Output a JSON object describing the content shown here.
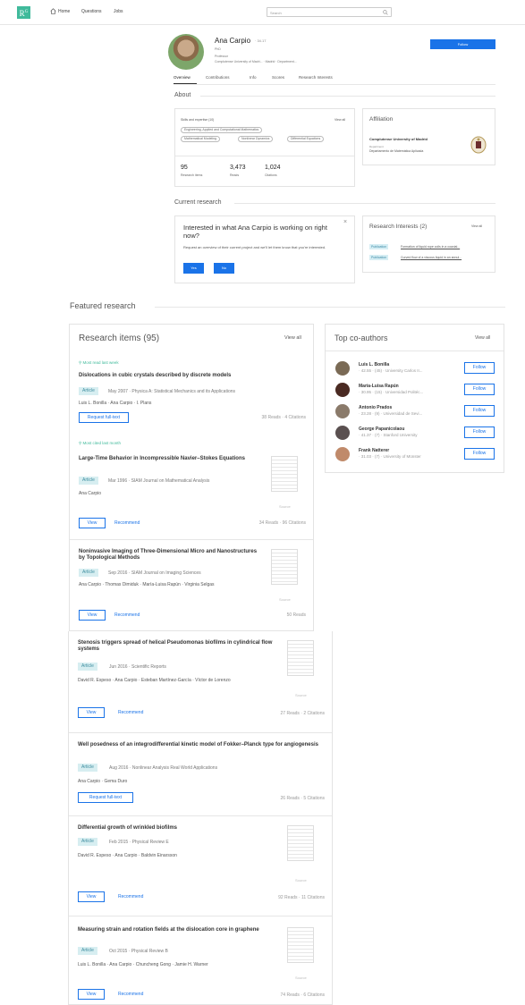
{
  "nav": {
    "logo": "R",
    "logo_sup": "G",
    "home": "Home",
    "questions": "Questions",
    "jobs": "Jobs",
    "search_placeholder": "Search"
  },
  "profile": {
    "name": "Ana Carpio",
    "score": "· 34.17",
    "degree": "PhD",
    "position": "Professor",
    "institution": "Complutense University of Madri... · Madrid · Department...",
    "follow": "Follow",
    "tabs": [
      "Overview",
      "Contributions",
      "Info",
      "Scores",
      "Research Interests"
    ]
  },
  "about": {
    "title": "About",
    "skills_label": "Skills and expertise (10)",
    "view_all": "View all",
    "skills": [
      "Engineering, Applied and Computational Mathematics",
      "Mathematical Modeling",
      "Nonlinear Dynamics",
      "Differential Equations"
    ],
    "stats": [
      {
        "num": "95",
        "label": "Research items"
      },
      {
        "num": "3,473",
        "label": "Reads"
      },
      {
        "num": "1,024",
        "label": "Citations"
      }
    ]
  },
  "affiliation": {
    "title": "Affiliation",
    "university": "Complutense University of Madrid",
    "dept_label": "Department",
    "dept": "Departamento de Matemática Aplicada"
  },
  "current_research": {
    "title": "Current research",
    "question": "Interested in what Ana Carpio is working on right now?",
    "desc": "Request an overview of their current project and we'll let them know that you're interested.",
    "yes": "Yes",
    "no": "No",
    "close": "×"
  },
  "interests": {
    "title": "Research Interests (2)",
    "view_all": "View all",
    "items": [
      {
        "tag": "Publication",
        "text": "Formation of liquid rope coils in a coaxial..."
      },
      {
        "tag": "Publication",
        "text": "Curved flow of a viscous liquid in an annul..."
      }
    ]
  },
  "featured": {
    "title": "Featured research",
    "items_title": "Research items (95)",
    "view_all": "View all",
    "most_read": "Most read last week",
    "most_cited": "Most cited last month",
    "source": "Source",
    "article": "Article",
    "items": [
      {
        "title": "Dislocations in cubic crystals described by discrete models",
        "date": "May 2007 · Physica A: Statistical Mechanics and its Applications",
        "authors": "Luis L. Bonilla · Ana Carpio · I. Plans",
        "btn1": "Request full-text",
        "stats": "38 Reads · 4 Citations"
      },
      {
        "title": "Large-Time Behavior in Incompressible Navier–Stokes Equations",
        "date": "Mar 1996 · SIAM Journal on Mathematical Analysis",
        "authors": "Ana Carpio",
        "btn1": "View",
        "btn2": "Recommend",
        "stats": "34 Reads · 96 Citations"
      },
      {
        "title": "Noninvasive Imaging of Three-Dimensional Micro and Nanostructures by Topological Methods",
        "date": "Sep 2016 · SIAM Journal on Imaging Sciences",
        "authors": "Ana Carpio · Thomas Dimiduk · María-Luisa Rapún · Virginia Selgas",
        "btn1": "View",
        "btn2": "Recommend",
        "stats": "50 Reads"
      },
      {
        "title": "Stenosis triggers spread of helical Pseudomonas biofilms in cylindrical flow systems",
        "date": "Jun 2016 · Scientific Reports",
        "authors": "David R. Espeso · Ana Carpio · Esteban Martínez-García · Víctor de Lorenzo",
        "btn1": "View",
        "btn2": "Recommend",
        "stats": "27 Reads · 2 Citations"
      },
      {
        "title": "Well posedness of an integrodifferential kinetic model of Fokker–Planck type for angiogenesis",
        "date": "Aug 2016 · Nonlinear Analysis Real World Applications",
        "authors": "Ana Carpio · Gema Duro",
        "btn1": "Request full-text",
        "stats": "26 Reads · 5 Citations"
      },
      {
        "title": "Differential growth of wrinkled biofilms",
        "date": "Feb 2015 · Physical Review E",
        "authors": "David R. Espeso · Ana Carpio · Baldvin Einarsson",
        "btn1": "View",
        "btn2": "Recommend",
        "stats": "92 Reads · 11 Citations"
      },
      {
        "title": "Measuring strain and rotation fields at the dislocation core in graphene",
        "date": "Oct 2015 · Physical Review B",
        "authors": "Luis L. Bonilla · Ana Carpio · Chuncheng Gong · Jamie H. Warner",
        "btn1": "View",
        "btn2": "Recommend",
        "stats": "74 Reads · 6 Citations"
      }
    ]
  },
  "coauthors": {
    "title": "Top co-authors",
    "view_all": "View all",
    "follow": "Follow",
    "items": [
      {
        "name": "Luis L. Bonilla",
        "meta": "· 42.55 · (45) · University Carlos II..."
      },
      {
        "name": "María-Luisa Rapún",
        "meta": "· 30.95 · (15) · Universidad Politéc..."
      },
      {
        "name": "Antonio Prados",
        "meta": "· 23.28 · (9) · Universidad de Sevi..."
      },
      {
        "name": "George Papanicolaou",
        "meta": "· 41.37 · (7) · Stanford University"
      },
      {
        "name": "Frank Natterer",
        "meta": "· 31.03 · (7) · University of Münster"
      }
    ]
  }
}
